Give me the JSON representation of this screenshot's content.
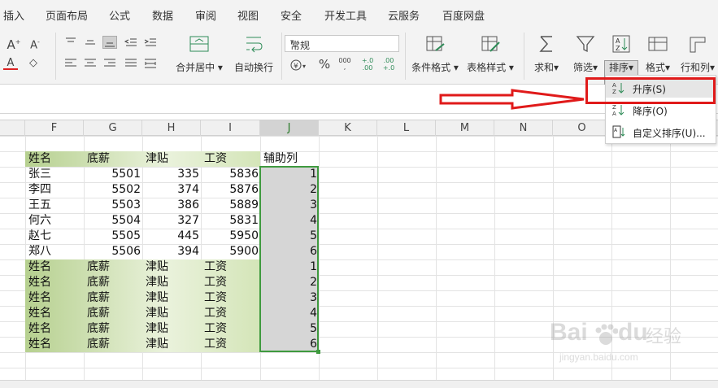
{
  "menu": [
    "插入",
    "页面布局",
    "公式",
    "数据",
    "审阅",
    "视图",
    "安全",
    "开发工具",
    "云服务",
    "百度网盘"
  ],
  "ribbon": {
    "merge_label": "合并居中",
    "wrap_label": "自动换行",
    "number_format": "常规",
    "cond_format_label": "条件格式",
    "table_style_label": "表格样式",
    "sum_label": "求和",
    "filter_label": "筛选",
    "sort_label": "排序",
    "format_label": "格式",
    "rowcol_label": "行和列",
    "currency_symbol": "¥",
    "percent_symbol": "%",
    "thousands_symbol": "000",
    "inc_decimal": "+.0 .00",
    "dec_decimal": ".00 +.0"
  },
  "columns": [
    "F",
    "G",
    "H",
    "I",
    "J",
    "K",
    "L",
    "M",
    "N",
    "O"
  ],
  "sheet": {
    "header_row": [
      "姓名",
      "底薪",
      "津贴",
      "工资",
      "辅助列"
    ],
    "rows": [
      {
        "name": "张三",
        "base": "5501",
        "allow": "335",
        "salary": "5836",
        "aux": "1"
      },
      {
        "name": "李四",
        "base": "5502",
        "allow": "374",
        "salary": "5876",
        "aux": "2"
      },
      {
        "name": "王五",
        "base": "5503",
        "allow": "386",
        "salary": "5889",
        "aux": "3"
      },
      {
        "name": "何六",
        "base": "5504",
        "allow": "327",
        "salary": "5831",
        "aux": "4"
      },
      {
        "name": "赵七",
        "base": "5505",
        "allow": "445",
        "salary": "5950",
        "aux": "5"
      },
      {
        "name": "郑八",
        "base": "5506",
        "allow": "394",
        "salary": "5900",
        "aux": "6"
      }
    ],
    "repeat_header": [
      "姓名",
      "底薪",
      "津贴",
      "工资"
    ],
    "repeat_aux": [
      "1",
      "2",
      "3",
      "4",
      "5",
      "6"
    ]
  },
  "sort_menu": {
    "ascending": "升序(S)",
    "descending": "降序(O)",
    "custom": "自定义排序(U)..."
  },
  "watermark": {
    "brand": "Bai",
    "brand2": "du",
    "brand_cn": "经验",
    "url": "jingyan.baidu.com"
  },
  "colors": {
    "accent_green": "#3f9a3f",
    "highlight_red": "#e01a1a",
    "header_fill": "#b6d08f"
  }
}
